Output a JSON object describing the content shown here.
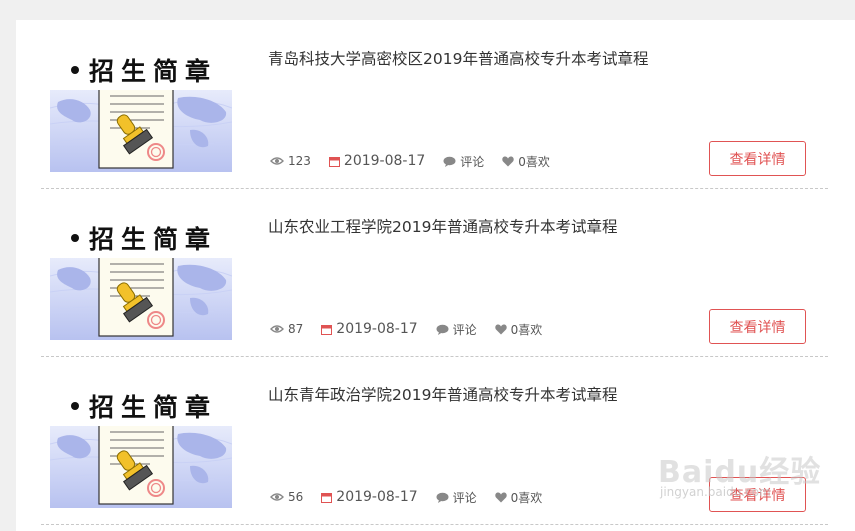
{
  "thumbnail_banner_text": "招生简章",
  "items": [
    {
      "title": "青岛科技大学高密校区2019年普通高校专升本考试章程",
      "views": "123",
      "date": "2019-08-17",
      "comment_label": "评论",
      "likes_label": "0喜欢",
      "detail_button": "查看详情"
    },
    {
      "title": "山东农业工程学院2019年普通高校专升本考试章程",
      "views": "87",
      "date": "2019-08-17",
      "comment_label": "评论",
      "likes_label": "0喜欢",
      "detail_button": "查看详情"
    },
    {
      "title": "山东青年政治学院2019年普通高校专升本考试章程",
      "views": "56",
      "date": "2019-08-17",
      "comment_label": "评论",
      "likes_label": "0喜欢",
      "detail_button": "查看详情"
    }
  ],
  "colors": {
    "accent": "#e05353",
    "page_bg": "#f0f0f0",
    "panel_bg": "#ffffff",
    "meta_icon": "#888888",
    "date_icon": "#e05353"
  },
  "icons": {
    "views": "eye-icon",
    "date": "calendar-icon",
    "comment": "speech-bubble-icon",
    "like": "heart-icon"
  },
  "watermark": {
    "logo_text": "Baidu经验",
    "url_text": "jingyan.baidu.com"
  }
}
